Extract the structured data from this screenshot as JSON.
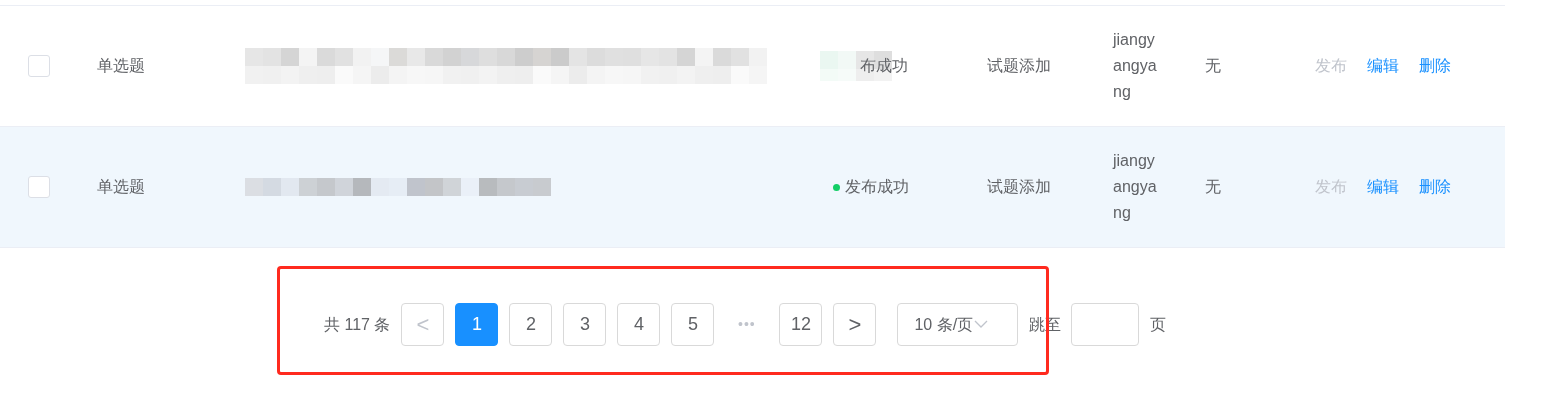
{
  "table": {
    "rows": [
      {
        "checked": false,
        "highlighted": false,
        "type": "单选题",
        "status": {
          "text": "布成功"
        },
        "source": "试题添加",
        "author": "jiangyangyang",
        "remark": "无",
        "actions": [
          {
            "label": "发布",
            "disabled": true
          },
          {
            "label": "编辑",
            "disabled": false
          },
          {
            "label": "删除",
            "disabled": false
          }
        ]
      },
      {
        "checked": false,
        "highlighted": true,
        "type": "单选题",
        "status": {
          "text": "发布成功",
          "color": "#13ce66"
        },
        "source": "试题添加",
        "author": "jiangyangyang",
        "remark": "无",
        "actions": [
          {
            "label": "发布",
            "disabled": true
          },
          {
            "label": "编辑",
            "disabled": false
          },
          {
            "label": "删除",
            "disabled": false
          }
        ]
      }
    ]
  },
  "pagination": {
    "total": "共 117 条",
    "prev": "<",
    "pages": [
      {
        "label": "1",
        "selected": true
      },
      {
        "label": "2",
        "selected": false
      },
      {
        "label": "3",
        "selected": false
      },
      {
        "label": "4",
        "selected": false
      },
      {
        "label": "5",
        "selected": false
      },
      {
        "label": "•••",
        "kind": "ellipsis"
      },
      {
        "label": "12",
        "selected": false
      }
    ],
    "next": ">",
    "page_size": "10 条/页",
    "jump_label": "跳至",
    "jump_suffix": "页"
  }
}
